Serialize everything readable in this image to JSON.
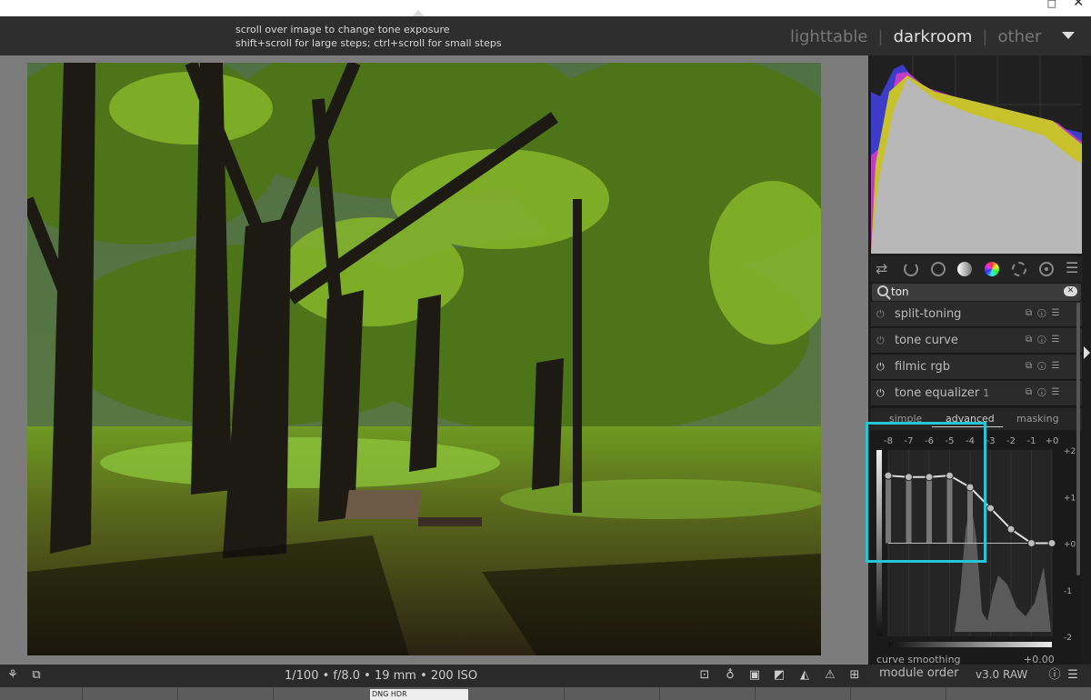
{
  "window": {
    "maximize_glyph": "□",
    "close_glyph": "✕"
  },
  "top": {
    "hint_line1": "scroll over image to change tone exposure",
    "hint_line2": "shift+scroll for large steps; ctrl+scroll for small steps",
    "views": [
      "lighttable",
      "darkroom",
      "other"
    ],
    "active_view": "darkroom"
  },
  "search": {
    "value": "ton",
    "clear_glyph": "✕"
  },
  "module_group_icons": [
    "quick-access-icon",
    "power-icon",
    "circle-base-icon",
    "tone-icon",
    "color-icon",
    "correct-icon",
    "effect-icon",
    "menu-icon"
  ],
  "modules": [
    {
      "name": "split-toning",
      "power": "⏻",
      "icons": "⧉ⓘ☰",
      "instance": ""
    },
    {
      "name": "tone curve",
      "power": "⏻",
      "icons": "⧉ⓘ☰",
      "instance": ""
    },
    {
      "name": "filmic rgb",
      "power": "⏻",
      "icons": "⧉ⓘ☰",
      "instance": ""
    },
    {
      "name": "tone equalizer",
      "power": "⏻",
      "icons": "⧉ⓘ☰",
      "instance": "1"
    }
  ],
  "tone_equalizer": {
    "tabs": [
      "simple",
      "advanced",
      "masking"
    ],
    "active_tab": "advanced",
    "x_labels": [
      "-8",
      "-7",
      "-6",
      "-5",
      "-4",
      "-3",
      "-2",
      "-1",
      "+0"
    ],
    "y_labels": [
      "+2",
      "+1",
      "+0",
      "-1",
      "-2"
    ],
    "curve_values": [
      1.45,
      1.42,
      1.42,
      1.45,
      1.2,
      0.75,
      0.3,
      0.0,
      0.0
    ],
    "curve_smoothing_label": "curve smoothing",
    "curve_smoothing_value": "+0.00"
  },
  "bottom": {
    "exif": "1/100 • f/8.0 • 19 mm • 200 ISO",
    "module_order_label": "module order",
    "module_order_value": "v3.0 RAW",
    "thumb_label": "DNG HDR"
  },
  "colors": {
    "highlight": "#26c6d6",
    "panel": "#2b2b2b",
    "background": "#7c7c7c"
  }
}
